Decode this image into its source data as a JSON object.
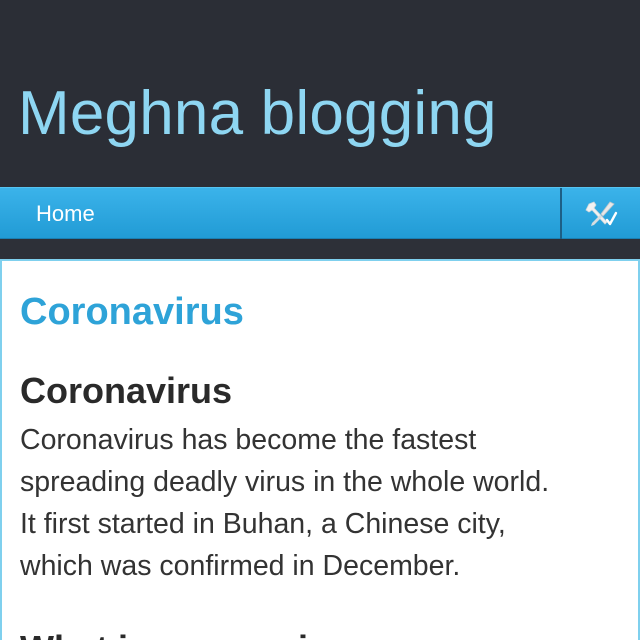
{
  "site": {
    "title": "Meghna blogging"
  },
  "nav": {
    "home_label": "Home",
    "tools_icon": "tools-icon"
  },
  "post": {
    "title": "Coronavirus",
    "heading": "Coronavirus",
    "body_lines": [
      "Coronavirus has become the fastest",
      "spreading deadly virus in the whole world.",
      "It first started in Buhan, a Chinese city,",
      "which was confirmed in December."
    ],
    "next_heading": "What is coronavirus"
  },
  "colors": {
    "header_bg": "#2b2e36",
    "title_color": "#8ed6f2",
    "nav_blue": "#2aa6df",
    "post_title_color": "#2ea3d8"
  }
}
